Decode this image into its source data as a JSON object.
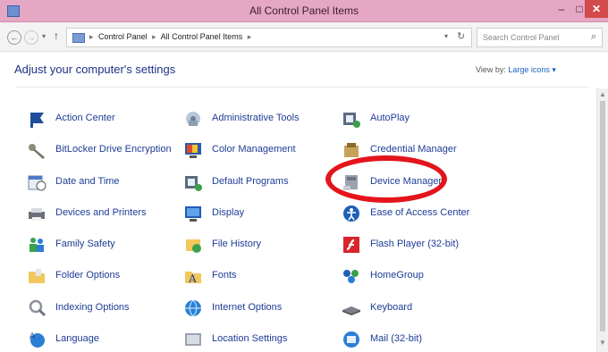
{
  "window": {
    "title": "All Control Panel Items",
    "minimize_glyph": "–",
    "maximize_glyph": "□",
    "close_glyph": "✕"
  },
  "nav": {
    "back_glyph": "←",
    "forward_glyph": "→",
    "dropdown_glyph": "▾",
    "up_glyph": "↑",
    "refresh_glyph": "↻",
    "address_dropdown_glyph": "▾"
  },
  "address": {
    "crumbs": [
      "Control Panel",
      "All Control Panel Items"
    ],
    "separator": "▸"
  },
  "search": {
    "placeholder": "Search Control Panel",
    "icon": "search-icon"
  },
  "page": {
    "heading": "Adjust your computer's settings",
    "view_by_label": "View by:",
    "view_by_value": "Large icons ▾"
  },
  "items": [
    {
      "label": "Action Center",
      "icon": "flag-icon"
    },
    {
      "label": "Administrative Tools",
      "icon": "tools-icon"
    },
    {
      "label": "AutoPlay",
      "icon": "autoplay-icon"
    },
    {
      "label": "BitLocker Drive Encryption",
      "icon": "key-icon"
    },
    {
      "label": "Color Management",
      "icon": "color-icon"
    },
    {
      "label": "Credential Manager",
      "icon": "credential-icon"
    },
    {
      "label": "Date and Time",
      "icon": "calendar-icon"
    },
    {
      "label": "Default Programs",
      "icon": "default-programs-icon"
    },
    {
      "label": "Device Manager",
      "icon": "device-manager-icon"
    },
    {
      "label": "Devices and Printers",
      "icon": "printer-icon"
    },
    {
      "label": "Display",
      "icon": "display-icon"
    },
    {
      "label": "Ease of Access Center",
      "icon": "ease-of-access-icon"
    },
    {
      "label": "Family Safety",
      "icon": "family-icon"
    },
    {
      "label": "File History",
      "icon": "file-history-icon"
    },
    {
      "label": "Flash Player (32-bit)",
      "icon": "flash-icon"
    },
    {
      "label": "Folder Options",
      "icon": "folder-icon"
    },
    {
      "label": "Fonts",
      "icon": "fonts-icon"
    },
    {
      "label": "HomeGroup",
      "icon": "homegroup-icon"
    },
    {
      "label": "Indexing Options",
      "icon": "indexing-icon"
    },
    {
      "label": "Internet Options",
      "icon": "internet-icon"
    },
    {
      "label": "Keyboard",
      "icon": "keyboard-icon"
    },
    {
      "label": "Language",
      "icon": "language-icon"
    },
    {
      "label": "Location Settings",
      "icon": "location-icon"
    },
    {
      "label": "Mail (32-bit)",
      "icon": "mail-icon"
    }
  ],
  "annotation": {
    "highlighted_item": "Device Manager",
    "color": "#e4141c"
  }
}
